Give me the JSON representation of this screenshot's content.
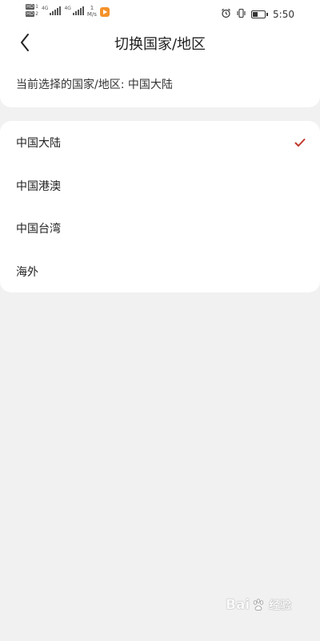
{
  "status_bar": {
    "hd_badges": [
      "HD",
      "HD"
    ],
    "hd_subs": [
      "1",
      "2"
    ],
    "sig1_label": "4G",
    "sig2_label": "4G",
    "speed_value": "1",
    "speed_unit": "M/s",
    "time": "5:50",
    "battery_level": 0.45
  },
  "header": {
    "title": "切换国家/地区"
  },
  "current": {
    "text": "当前选择的国家/地区: 中国大陆"
  },
  "regions": [
    {
      "label": "中国大陆",
      "selected": true
    },
    {
      "label": "中国港澳",
      "selected": false
    },
    {
      "label": "中国台湾",
      "selected": false
    },
    {
      "label": "海外",
      "selected": false
    }
  ],
  "colors": {
    "accent": "#c0392b",
    "notif_app": "#f4922a",
    "background": "#f1f1f1"
  },
  "watermark": {
    "brand": "Bai",
    "brand_end": "",
    "cn": "经验"
  }
}
